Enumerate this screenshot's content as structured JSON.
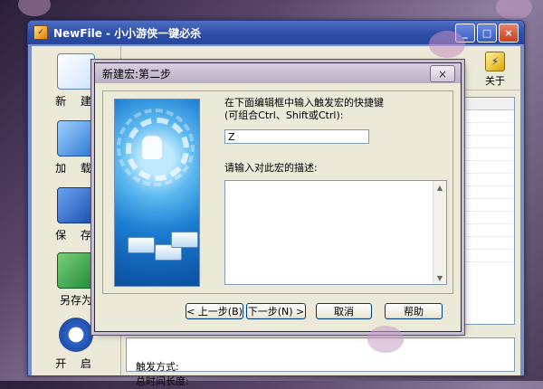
{
  "main_window": {
    "title": "NewFile - 小小游侠一键必杀",
    "title_buttons": [
      "_",
      "□",
      "×"
    ],
    "left_toolbar": [
      {
        "label": "新 建",
        "icon": "new-file-icon"
      },
      {
        "label": "加 载",
        "icon": "open-folder-icon"
      },
      {
        "label": "保 存",
        "icon": "floppy-save-icon"
      },
      {
        "label": "另存为",
        "icon": "floppy-saveas-icon"
      },
      {
        "label": "开 启",
        "icon": "play-icon"
      }
    ],
    "top_toolbar": {
      "about_label": "关于",
      "about_icon": "lightning-icon"
    },
    "info": {
      "trigger_label": "触发方式:",
      "duration_label": "总时间长度:"
    }
  },
  "dialog": {
    "title": "新建宏:第二步",
    "close_label": "×",
    "prompt_shortcut": "在下面编辑框中输入触发宏的快捷键(可组合Ctrl、Shift或Ctrl):",
    "shortcut_value": "Z",
    "prompt_description": "请输入对此宏的描述:",
    "description_value": "",
    "buttons": {
      "prev": "< 上一步(B)",
      "next": "下一步(N) >",
      "cancel": "取消",
      "help": "帮助"
    }
  },
  "colors": {
    "titlebar": "#2f4fa9",
    "dialog_frame": "#b9aec6",
    "face": "#ece9d8"
  }
}
